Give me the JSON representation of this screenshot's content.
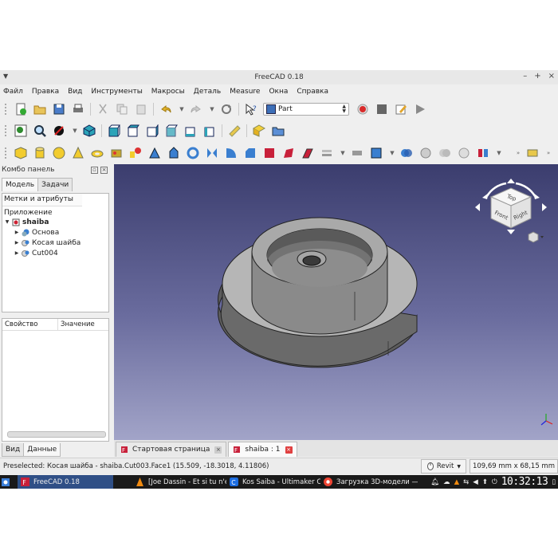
{
  "window": {
    "title": "FreeCAD 0.18"
  },
  "menubar": {
    "items": [
      "Файл",
      "Правка",
      "Вид",
      "Инструменты",
      "Макросы",
      "Деталь",
      "Measure",
      "Окна",
      "Справка"
    ]
  },
  "toolbar": {
    "workbench": "Part"
  },
  "combo": {
    "title": "Комбо панель",
    "tabs": [
      "Модель",
      "Задачи"
    ],
    "tree_header": "Метки и атрибуты",
    "section": "Приложение",
    "tree": [
      {
        "label": "shaiba",
        "level": 0,
        "expanded": true,
        "bold": true
      },
      {
        "label": "Основа",
        "level": 1
      },
      {
        "label": "Косая шайба",
        "level": 1
      },
      {
        "label": "Cut004",
        "level": 1
      }
    ],
    "props_columns": [
      "Свойство",
      "Значение"
    ],
    "bottom_tabs": [
      "Вид",
      "Данные"
    ]
  },
  "navcube": {
    "faces": [
      "Top",
      "Front",
      "Right"
    ]
  },
  "doc_tabs": [
    {
      "label": "Стартовая страница",
      "active": false
    },
    {
      "label": "shaiba : 1",
      "active": true
    }
  ],
  "status": {
    "text": "Preselected: Косая шайба - shaiba.Cut003.Face1 (15.509, -18.3018, 4.11806)",
    "nav_style": "Revit",
    "dims": "109,69 mm x 68,15 mm"
  },
  "taskbar": {
    "tasks": [
      {
        "label": "FreeCAD 0.18",
        "active": true
      },
      {
        "label": "[Joe Dassin - Et si tu n'ex...",
        "active": false
      },
      {
        "label": "Kos Saiba - Ultimaker C...",
        "active": false
      },
      {
        "label": "Загрузка 3D-модели —...",
        "active": false
      }
    ],
    "clock": "10:32:13"
  }
}
